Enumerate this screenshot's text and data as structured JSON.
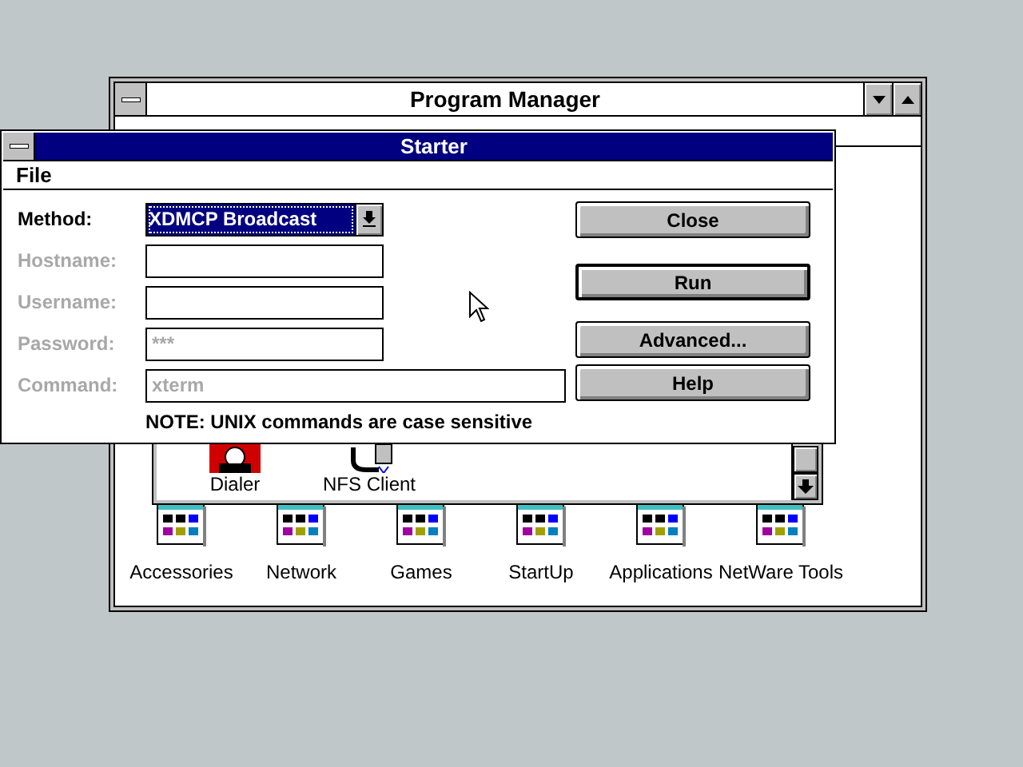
{
  "program_manager": {
    "title": "Program Manager",
    "group_window": {
      "icons": [
        {
          "label": "Dialer",
          "kind": "dialer"
        },
        {
          "label": "NFS Client",
          "kind": "plug"
        }
      ]
    },
    "group_icons": [
      {
        "label": "Accessories"
      },
      {
        "label": "Network"
      },
      {
        "label": "Games"
      },
      {
        "label": "StartUp"
      },
      {
        "label": "Applications"
      },
      {
        "label": "NetWare Tools"
      }
    ]
  },
  "starter": {
    "title": "Starter",
    "menu": [
      "File"
    ],
    "fields": [
      {
        "label": "Method:",
        "kind": "combo",
        "value": "XDMCP Broadcast",
        "disabled": false,
        "focused": true
      },
      {
        "label": "Hostname:",
        "kind": "text",
        "disabled": true
      },
      {
        "label": "Username:",
        "kind": "text",
        "disabled": true
      },
      {
        "label": "Password:",
        "kind": "text",
        "value": "***",
        "disabled": true
      },
      {
        "label": "Command:",
        "kind": "wide",
        "value": "xterm",
        "disabled": true
      }
    ],
    "note": "NOTE: UNIX commands are case sensitive",
    "buttons": [
      {
        "label": "Close",
        "default": false
      },
      {
        "label": "Run",
        "default": true
      },
      {
        "label": "Advanced...",
        "default": false
      },
      {
        "label": "Help",
        "default": false
      }
    ]
  }
}
